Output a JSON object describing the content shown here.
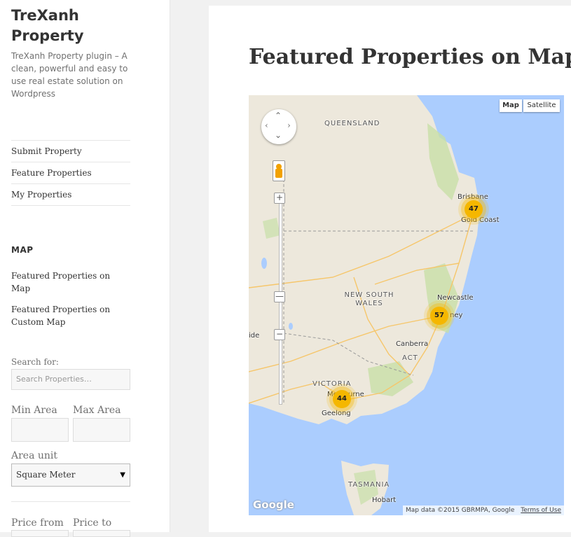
{
  "site": {
    "title": "TreXanh Property",
    "description": "TreXanh Property plugin – A clean, powerful and easy to use real estate solution on Wordpress"
  },
  "nav": {
    "items": [
      {
        "label": "Submit Property"
      },
      {
        "label": "Feature Properties"
      },
      {
        "label": "My Properties"
      }
    ]
  },
  "map_widget": {
    "title": "MAP",
    "links": [
      {
        "label": "Featured Properties on Map"
      },
      {
        "label": "Featured Properties on Custom Map"
      }
    ]
  },
  "search": {
    "label": "Search for:",
    "placeholder": "Search Properties…",
    "min_area_label": "Min Area",
    "max_area_label": "Max Area",
    "area_unit_label": "Area unit",
    "area_unit_value": "Square Meter",
    "price_from_label": "Price from",
    "price_to_label": "Price to"
  },
  "page": {
    "title": "Featured Properties on Map"
  },
  "map": {
    "type_buttons": {
      "map": "Map",
      "satellite": "Satellite"
    },
    "labels": {
      "queensland": "QUEENSLAND",
      "nsw": "NEW SOUTH WALES",
      "victoria": "VICTORIA",
      "tasmania": "TASMANIA",
      "brisbane": "Brisbane",
      "gold_coast": "Gold Coast",
      "newcastle": "Newcastle",
      "sydney": "ney",
      "canberra": "Canberra",
      "act": "ACT",
      "melbourne": "Melbourne",
      "geelong": "Geelong",
      "hobart": "Hobart",
      "mildura": "ide"
    },
    "clusters": [
      {
        "name": "brisbane-cluster",
        "count": "47"
      },
      {
        "name": "sydney-cluster",
        "count": "57"
      },
      {
        "name": "melbourne-cluster",
        "count": "44"
      }
    ],
    "zoom_in": "+",
    "zoom_out": "−",
    "attribution": "Map data ©2015 GBRMPA, Google",
    "terms": "Terms of Use",
    "logo": "Google"
  },
  "colors": {
    "land": "#ede8dc",
    "sea": "#abcdfe",
    "park": "#c8dfa8",
    "road": "#f6c66a",
    "cluster": "#f5b700"
  }
}
